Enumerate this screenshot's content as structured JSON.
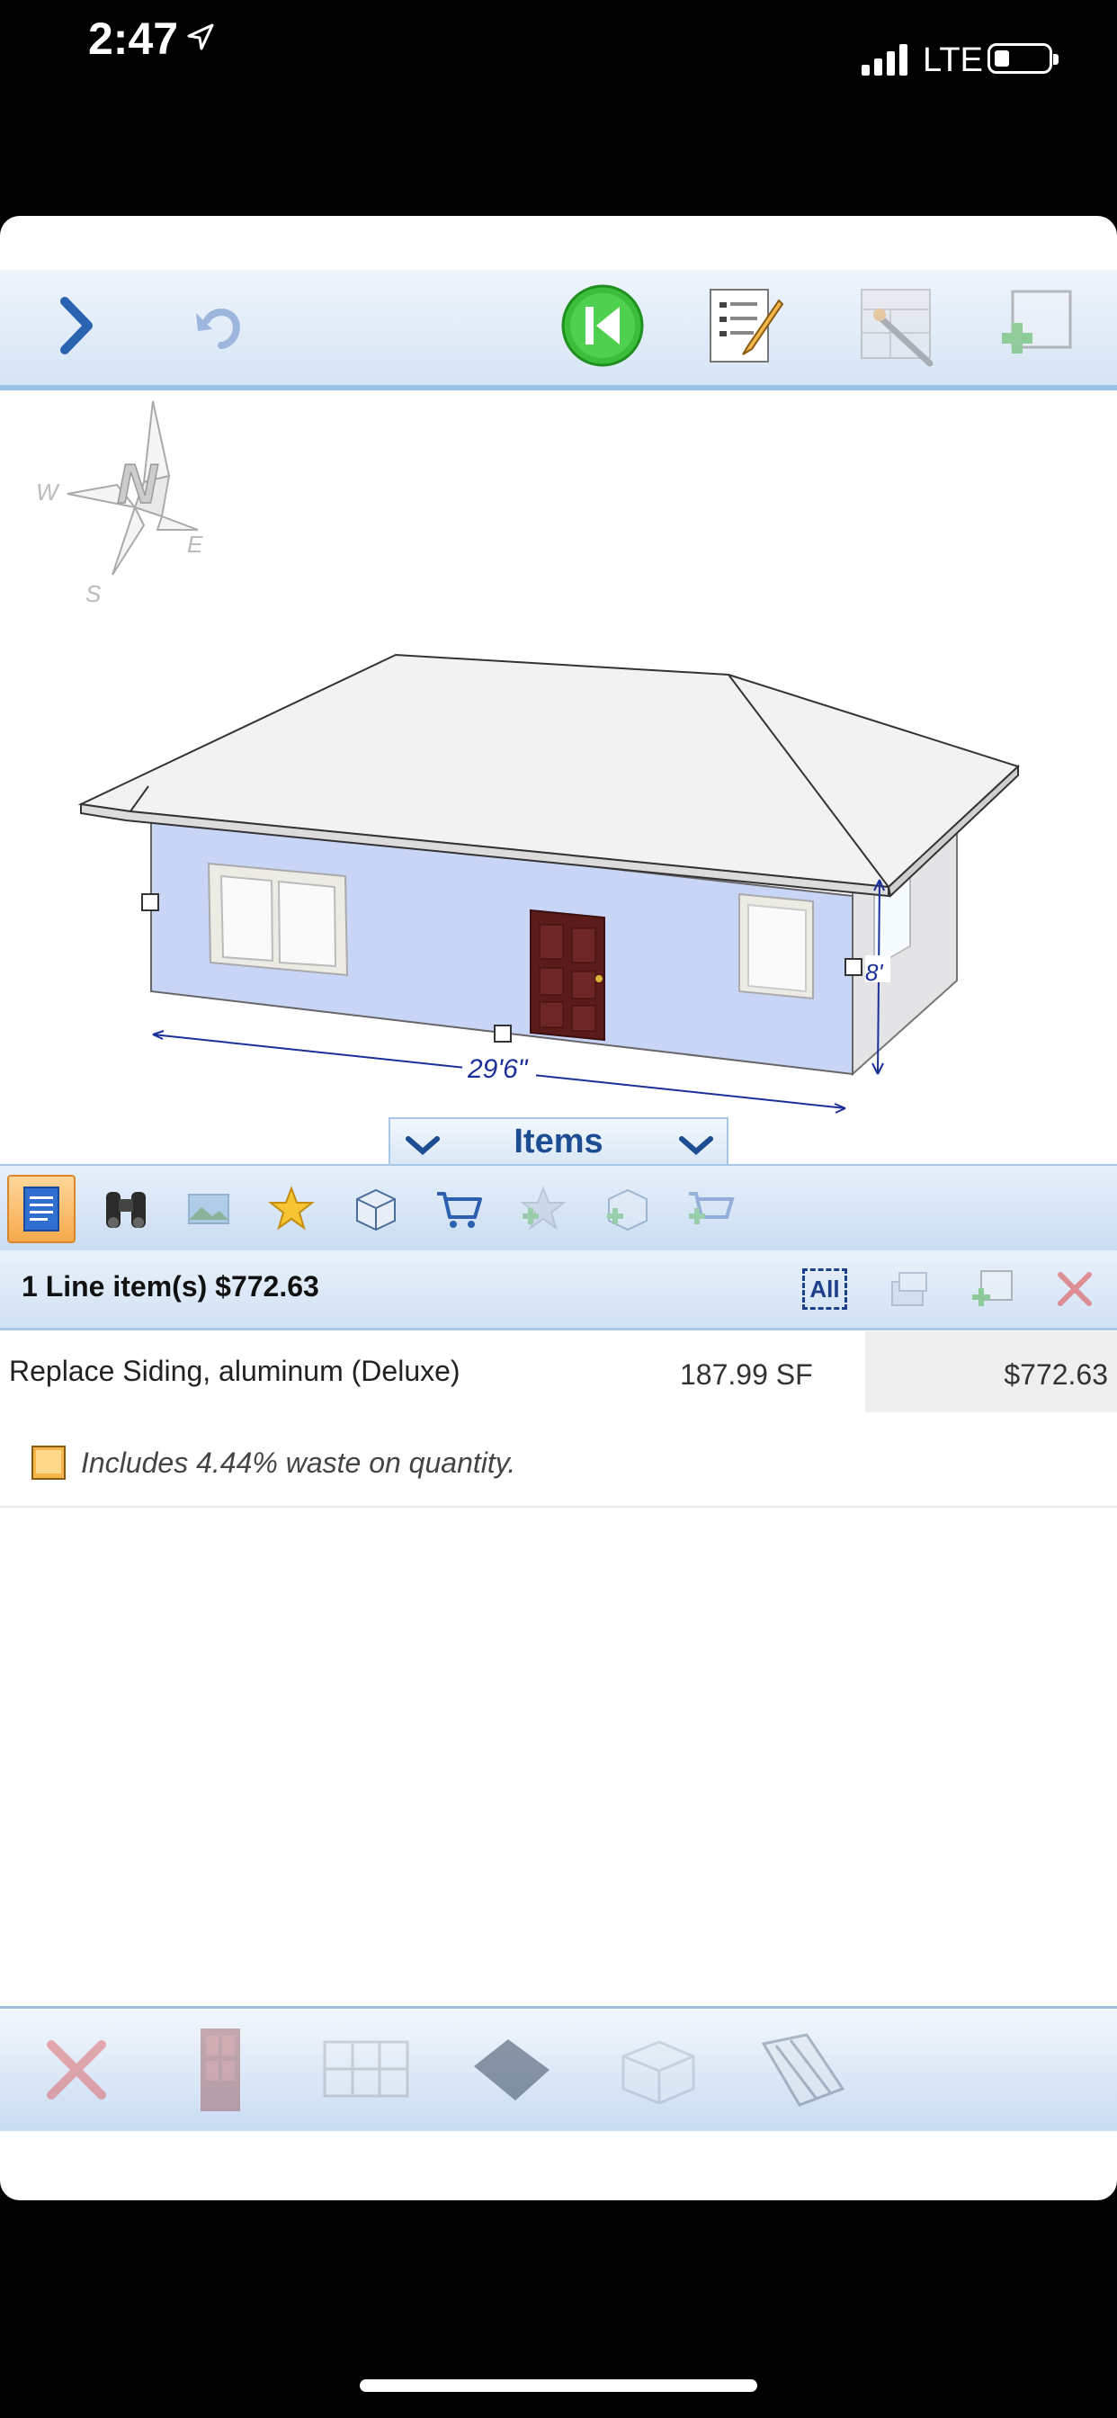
{
  "status": {
    "time": "2:47",
    "network": "LTE"
  },
  "toolbar": {
    "icons": [
      "chevron-right-icon",
      "undo-icon",
      "skip-to-start-icon",
      "edit-notes-icon",
      "magic-wand-icon",
      "add-item-icon"
    ]
  },
  "sketch": {
    "compass": {
      "n": "N",
      "e": "E",
      "s": "S",
      "w": "W"
    },
    "dimension_width": "29'6\"",
    "dimension_height": "8'"
  },
  "items_tab": {
    "label": "Items"
  },
  "iconbar": {
    "icons": [
      "line-items-icon",
      "binoculars-icon",
      "photo-icon",
      "star-icon",
      "box-icon",
      "cart-icon",
      "star-add-icon",
      "box-add-icon",
      "cart-add-icon"
    ]
  },
  "summary": {
    "text": "1 Line item(s)  $772.63",
    "all_button": "All"
  },
  "line_items": [
    {
      "description": "Replace Siding, aluminum (Deluxe)",
      "quantity": "187.99 SF",
      "total": "$772.63"
    }
  ],
  "note": {
    "text": "Includes 4.44% waste on quantity."
  },
  "bottombar": {
    "icons": [
      "delete-icon",
      "door-icon",
      "window-icon",
      "floor-plane-icon",
      "cube-icon",
      "roof-pitch-icon"
    ]
  },
  "colors": {
    "accent": "#1e4c93",
    "toolbar_border": "#9cc3e6"
  }
}
